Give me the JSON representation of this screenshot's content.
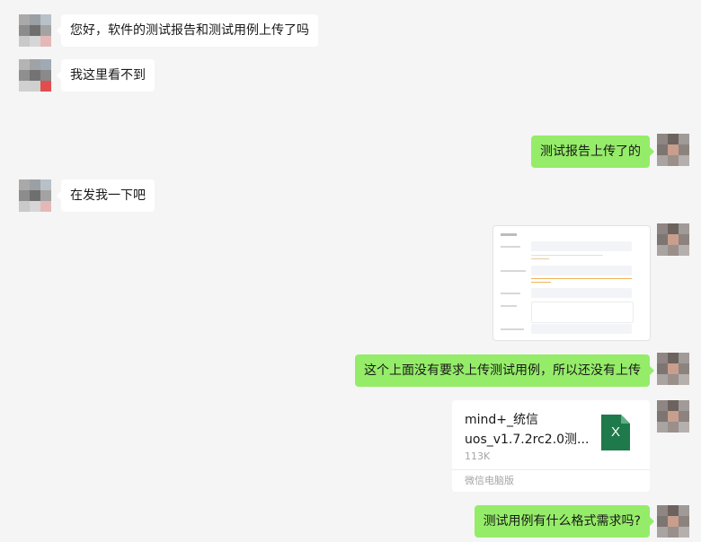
{
  "messages": [
    {
      "side": "left",
      "type": "text",
      "text": "您好，软件的测试报告和测试用例上传了吗"
    },
    {
      "side": "left",
      "type": "text",
      "text": "我这里看不到"
    },
    {
      "side": "right",
      "type": "text",
      "text": "测试报告上传了的"
    },
    {
      "side": "left",
      "type": "text",
      "text": "在发我一下吧"
    },
    {
      "side": "right",
      "type": "image",
      "icon": "screenshot-thumbnail"
    },
    {
      "side": "right",
      "type": "text",
      "text": "这个上面没有要求上传测试用例，所以还没有上传"
    },
    {
      "side": "right",
      "type": "file",
      "file_name": "mind+_统信uos_v1.7.2rc2.0测...",
      "file_size": "113K",
      "source": "微信电脑版",
      "icon": "excel-file-icon",
      "icon_letter": "X",
      "icon_color": "#1e7a4a"
    },
    {
      "side": "right",
      "type": "text",
      "text": "测试用例有什么格式需求吗?"
    }
  ],
  "colors": {
    "background": "#f5f5f5",
    "incoming_bubble": "#ffffff",
    "outgoing_bubble": "#95ec69",
    "excel_green": "#1e7a4a"
  }
}
